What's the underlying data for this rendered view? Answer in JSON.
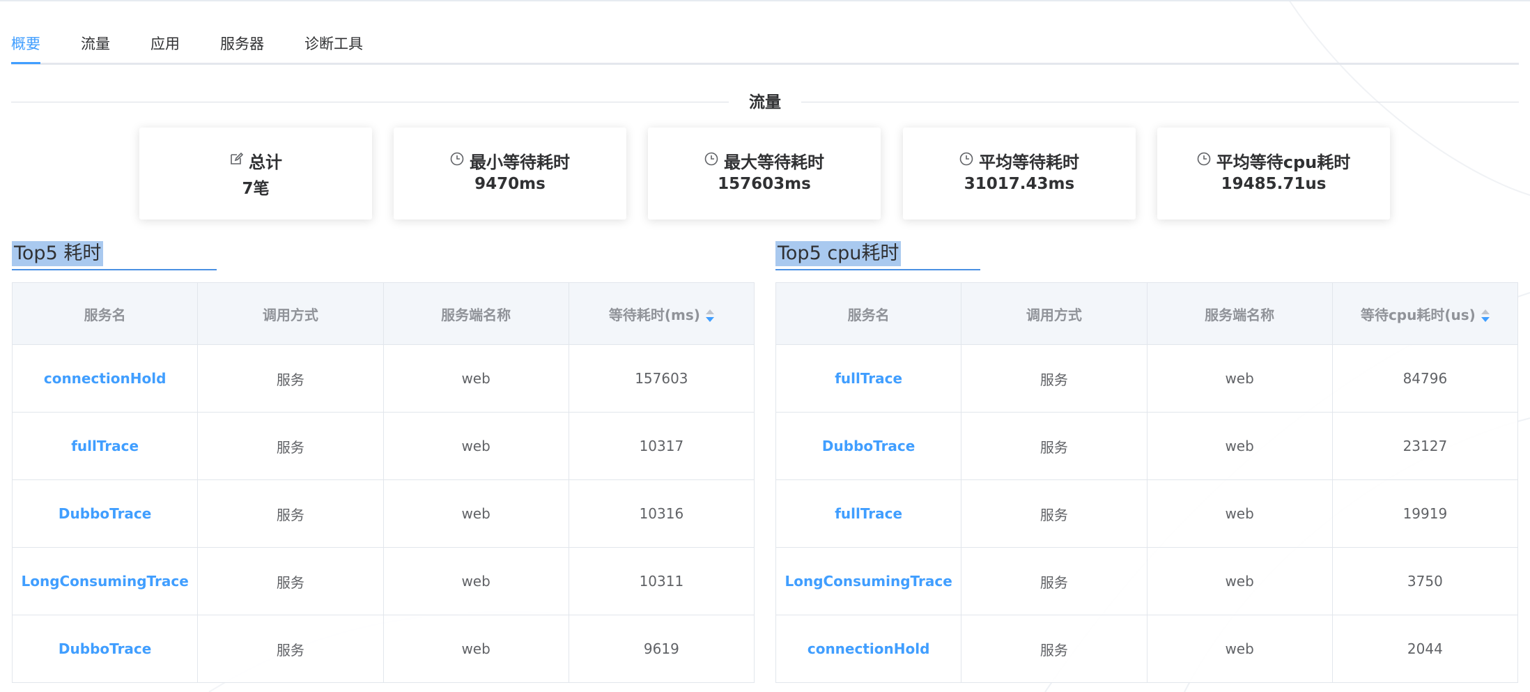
{
  "tabs": [
    {
      "label": "概要"
    },
    {
      "label": "流量"
    },
    {
      "label": "应用"
    },
    {
      "label": "服务器"
    },
    {
      "label": "诊断工具"
    }
  ],
  "divider_title": "流量",
  "stats": [
    {
      "icon": "edit-icon",
      "label": "总计",
      "value": "7笔"
    },
    {
      "icon": "clock-icon",
      "label": "最小等待耗时",
      "value": "9470ms"
    },
    {
      "icon": "clock-icon",
      "label": "最大等待耗时",
      "value": "157603ms"
    },
    {
      "icon": "clock-icon",
      "label": "平均等待耗时",
      "value": "31017.43ms"
    },
    {
      "icon": "clock-icon",
      "label": "平均等待cpu耗时",
      "value": "19485.71us"
    }
  ],
  "top5_time": {
    "title": "Top5 耗时",
    "headers": [
      "服务名",
      "调用方式",
      "服务端名称",
      "等待耗时(ms)"
    ],
    "rows": [
      [
        "connectionHold",
        "服务",
        "web",
        "157603"
      ],
      [
        "fullTrace",
        "服务",
        "web",
        "10317"
      ],
      [
        "DubboTrace",
        "服务",
        "web",
        "10316"
      ],
      [
        "LongConsumingTrace",
        "服务",
        "web",
        "10311"
      ],
      [
        "DubboTrace",
        "服务",
        "web",
        "9619"
      ]
    ]
  },
  "top5_cpu": {
    "title": "Top5 cpu耗时",
    "headers": [
      "服务名",
      "调用方式",
      "服务端名称",
      "等待cpu耗时(us)"
    ],
    "rows": [
      [
        "fullTrace",
        "服务",
        "web",
        "84796"
      ],
      [
        "DubboTrace",
        "服务",
        "web",
        "23127"
      ],
      [
        "fullTrace",
        "服务",
        "web",
        "19919"
      ],
      [
        "LongConsumingTrace",
        "服务",
        "web",
        "3750"
      ],
      [
        "connectionHold",
        "服务",
        "web",
        "2044"
      ]
    ]
  },
  "colors": {
    "accent": "#409eff",
    "title_highlight": "#a9c9ef",
    "header_bg": "#f3f6fa"
  }
}
